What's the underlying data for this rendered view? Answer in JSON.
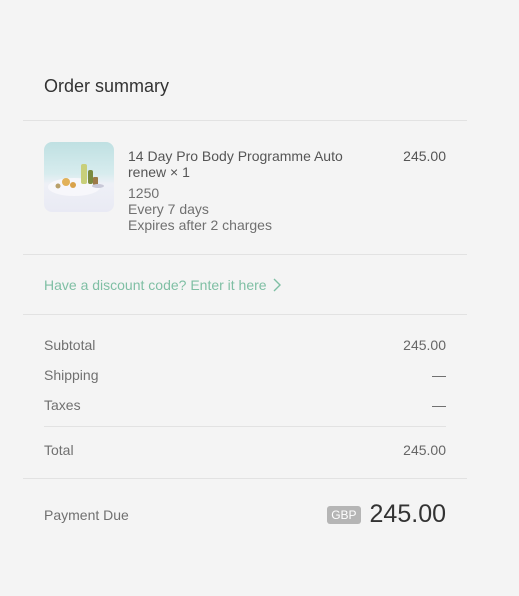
{
  "summary": {
    "title": "Order summary"
  },
  "item": {
    "name_line1": "14 Day Pro Body Programme Auto",
    "name_line2": "renew × 1",
    "variant": "1250",
    "frequency": "Every 7 days",
    "expiry": "Expires after 2 charges",
    "price": "245.00",
    "thumbnail_icon": "product-image"
  },
  "discount": {
    "label": "Have a discount code? Enter it here",
    "icon": "chevron-right-icon",
    "color": "#7fbfa4"
  },
  "totals": {
    "subtotal_label": "Subtotal",
    "subtotal_value": "245.00",
    "shipping_label": "Shipping",
    "shipping_value": "—",
    "taxes_label": "Taxes",
    "taxes_value": "—",
    "total_label": "Total",
    "total_value": "245.00"
  },
  "payment": {
    "label": "Payment Due",
    "currency": "GBP",
    "amount": "245.00"
  }
}
